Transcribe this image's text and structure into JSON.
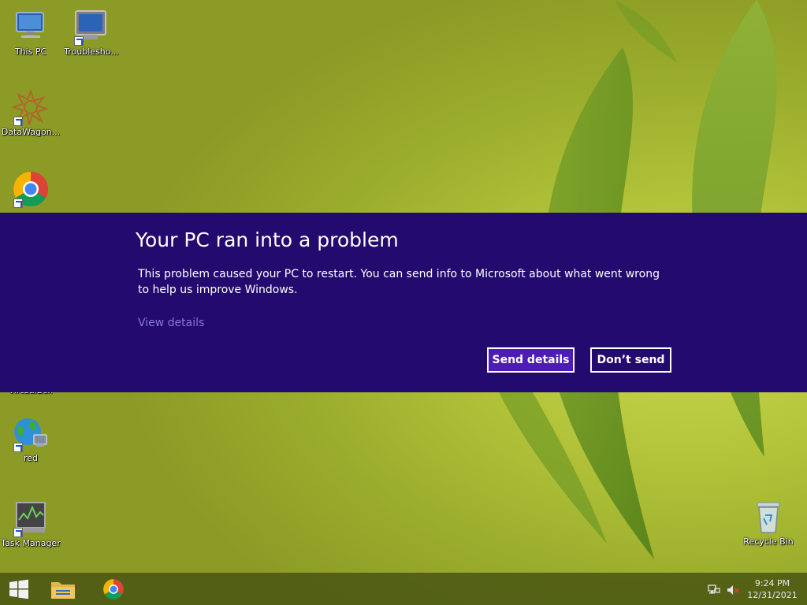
{
  "desktop": {
    "icons": [
      {
        "label": "This PC",
        "icon": "computer-icon"
      },
      {
        "label": "Troublesho...",
        "icon": "troubleshoot-icon"
      },
      {
        "label": "DataWagon...",
        "icon": "datawagon-icon"
      },
      {
        "label": "",
        "icon": "chrome-icon"
      },
      {
        "label": "VirtualBox",
        "icon": "virtualbox-icon"
      },
      {
        "label": "red",
        "icon": "network-globe-icon"
      },
      {
        "label": "Task Manager",
        "icon": "task-manager-icon"
      },
      {
        "label": "Recycle Bin",
        "icon": "recycle-bin-icon"
      }
    ]
  },
  "error_dialog": {
    "title": "Your PC ran into a problem",
    "message": "This problem caused your PC to restart. You can send info to Microsoft about what went wrong to help us improve Windows.",
    "link": "View details",
    "send_button": "Send details",
    "dont_send_button": "Don’t send"
  },
  "taskbar": {
    "start": "windows-start-icon",
    "pinned": [
      "file-explorer-icon",
      "chrome-icon"
    ],
    "tray": [
      "network-icon",
      "volume-muted-icon"
    ],
    "time": "9:24 PM",
    "date": "12/31/2021"
  },
  "colors": {
    "banner": "#220a6e",
    "primary_button": "#4d1cb7",
    "link": "#8a78e0",
    "desktop": "#b3c43a"
  }
}
